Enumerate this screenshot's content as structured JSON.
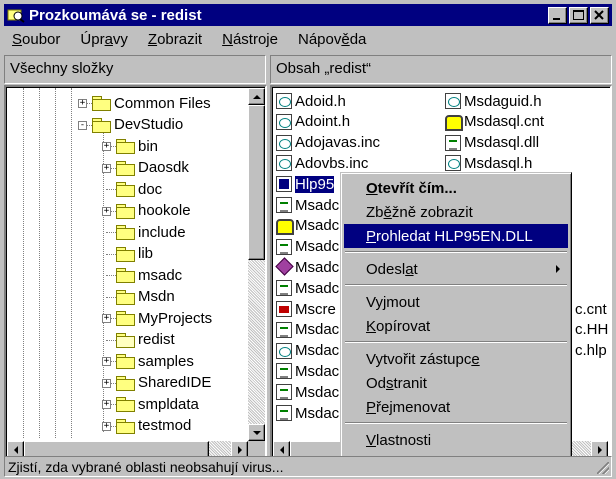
{
  "window": {
    "title": "Prozkoumává se - redist",
    "titlebar_color": "#000080"
  },
  "menubar": [
    {
      "label": "Soubor",
      "accel": "S",
      "rest": "oubor"
    },
    {
      "label": "Úpravy",
      "pre": "Úpr",
      "accel": "a",
      "rest": "vy"
    },
    {
      "label": "Zobrazit",
      "accel": "Z",
      "rest": "obrazit"
    },
    {
      "label": "Nástroje",
      "accel": "N",
      "rest": "ástroje"
    },
    {
      "label": "Nápověda",
      "pre": "Nápov",
      "accel": "ě",
      "rest": "da"
    }
  ],
  "left_pane": {
    "header": "Všechny složky",
    "tree": [
      {
        "label": "Common Files",
        "expander": "+"
      },
      {
        "label": "DevStudio",
        "expander": "-"
      },
      {
        "label": "bin",
        "expander": "+"
      },
      {
        "label": "Daosdk",
        "expander": "+"
      },
      {
        "label": "doc",
        "expander": ""
      },
      {
        "label": "hookole",
        "expander": "+"
      },
      {
        "label": "include",
        "expander": ""
      },
      {
        "label": "lib",
        "expander": ""
      },
      {
        "label": "msadc",
        "expander": ""
      },
      {
        "label": "Msdn",
        "expander": ""
      },
      {
        "label": "MyProjects",
        "expander": "+"
      },
      {
        "label": "redist",
        "expander": "",
        "open": true
      },
      {
        "label": "samples",
        "expander": "+"
      },
      {
        "label": "SharedIDE",
        "expander": "+"
      },
      {
        "label": "smpldata",
        "expander": "+"
      },
      {
        "label": "testmod",
        "expander": "+"
      }
    ]
  },
  "right_pane": {
    "header": "Obsah „redist“",
    "col1": [
      {
        "name": "Adoid.h",
        "icon": "h"
      },
      {
        "name": "Adoint.h",
        "icon": "h"
      },
      {
        "name": "Adojavas.inc",
        "icon": "h"
      },
      {
        "name": "Adovbs.inc",
        "icon": "h"
      },
      {
        "name": "Hlp95",
        "icon": "exe",
        "selected": true
      },
      {
        "name": "Msadc",
        "icon": "inc"
      },
      {
        "name": "Msadc",
        "icon": "cnt"
      },
      {
        "name": "Msadc",
        "icon": "inc"
      },
      {
        "name": "Msadc",
        "icon": "hh"
      },
      {
        "name": "Msadc",
        "icon": "inc"
      },
      {
        "name": "Mscre",
        "icon": "hlp"
      },
      {
        "name": "Msdac",
        "icon": "inc"
      },
      {
        "name": "Msdac",
        "icon": "h"
      },
      {
        "name": "Msdac",
        "icon": "inc"
      },
      {
        "name": "Msdac",
        "icon": "inc"
      },
      {
        "name": "Msdac",
        "icon": "inc"
      }
    ],
    "col2": [
      {
        "name": "Msdaguid.h",
        "icon": "h"
      },
      {
        "name": "Msdasql.cnt",
        "icon": "cnt"
      },
      {
        "name": "Msdasql.dll",
        "icon": "inc"
      },
      {
        "name": "Msdasql.h",
        "icon": "h"
      }
    ],
    "col2_partial": [
      "c.cnt",
      "c.HH",
      "c.hlp"
    ]
  },
  "context_menu": [
    {
      "type": "item",
      "pre": "",
      "accel": "O",
      "rest": "tevřít čím...",
      "bold": true
    },
    {
      "type": "item",
      "pre": "Zb",
      "accel": "ě",
      "rest": "žně zobrazit"
    },
    {
      "type": "item",
      "pre": "",
      "accel": "P",
      "rest": "rohledat HLP95EN.DLL",
      "highlighted": true
    },
    {
      "type": "sep"
    },
    {
      "type": "item",
      "pre": "Odesl",
      "accel": "a",
      "rest": "t",
      "submenu": true
    },
    {
      "type": "sep"
    },
    {
      "type": "item",
      "pre": "Vy",
      "accel": "j",
      "rest": "mout"
    },
    {
      "type": "item",
      "pre": "",
      "accel": "K",
      "rest": "opírovat"
    },
    {
      "type": "sep"
    },
    {
      "type": "item",
      "pre": "Vytvořit zástupc",
      "accel": "e",
      "rest": ""
    },
    {
      "type": "item",
      "pre": "Od",
      "accel": "s",
      "rest": "tranit"
    },
    {
      "type": "item",
      "pre": "",
      "accel": "P",
      "rest": "řejmenovat"
    },
    {
      "type": "sep"
    },
    {
      "type": "item",
      "pre": "",
      "accel": "V",
      "rest": "lastnosti"
    }
  ],
  "status_bar": {
    "text": "Zjistí, zda vybrané oblasti neobsahují virus..."
  }
}
